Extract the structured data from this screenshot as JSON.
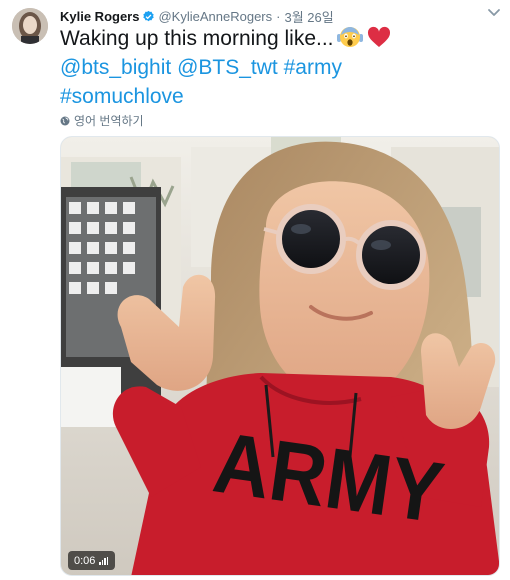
{
  "tweet": {
    "display_name": "Kylie Rogers",
    "handle": "@KylieAnneRogers",
    "separator": "·",
    "time": "3월 26일",
    "text_plain": "Waking up this morning like...",
    "links": [
      "@bts_bighit",
      "@BTS_twt",
      "#army",
      "#somuchlove"
    ],
    "emoji": [
      "face-screaming-emoji",
      "red-heart-emoji"
    ],
    "translate_label": "영어 번역하기"
  },
  "media": {
    "type": "video",
    "duration": "0:06",
    "shirt_text": "ARMY"
  },
  "colors": {
    "link": "#1b95e0",
    "secondary": "#657786",
    "verified": "#1da1f2",
    "hoodie": "#c81d2c"
  }
}
